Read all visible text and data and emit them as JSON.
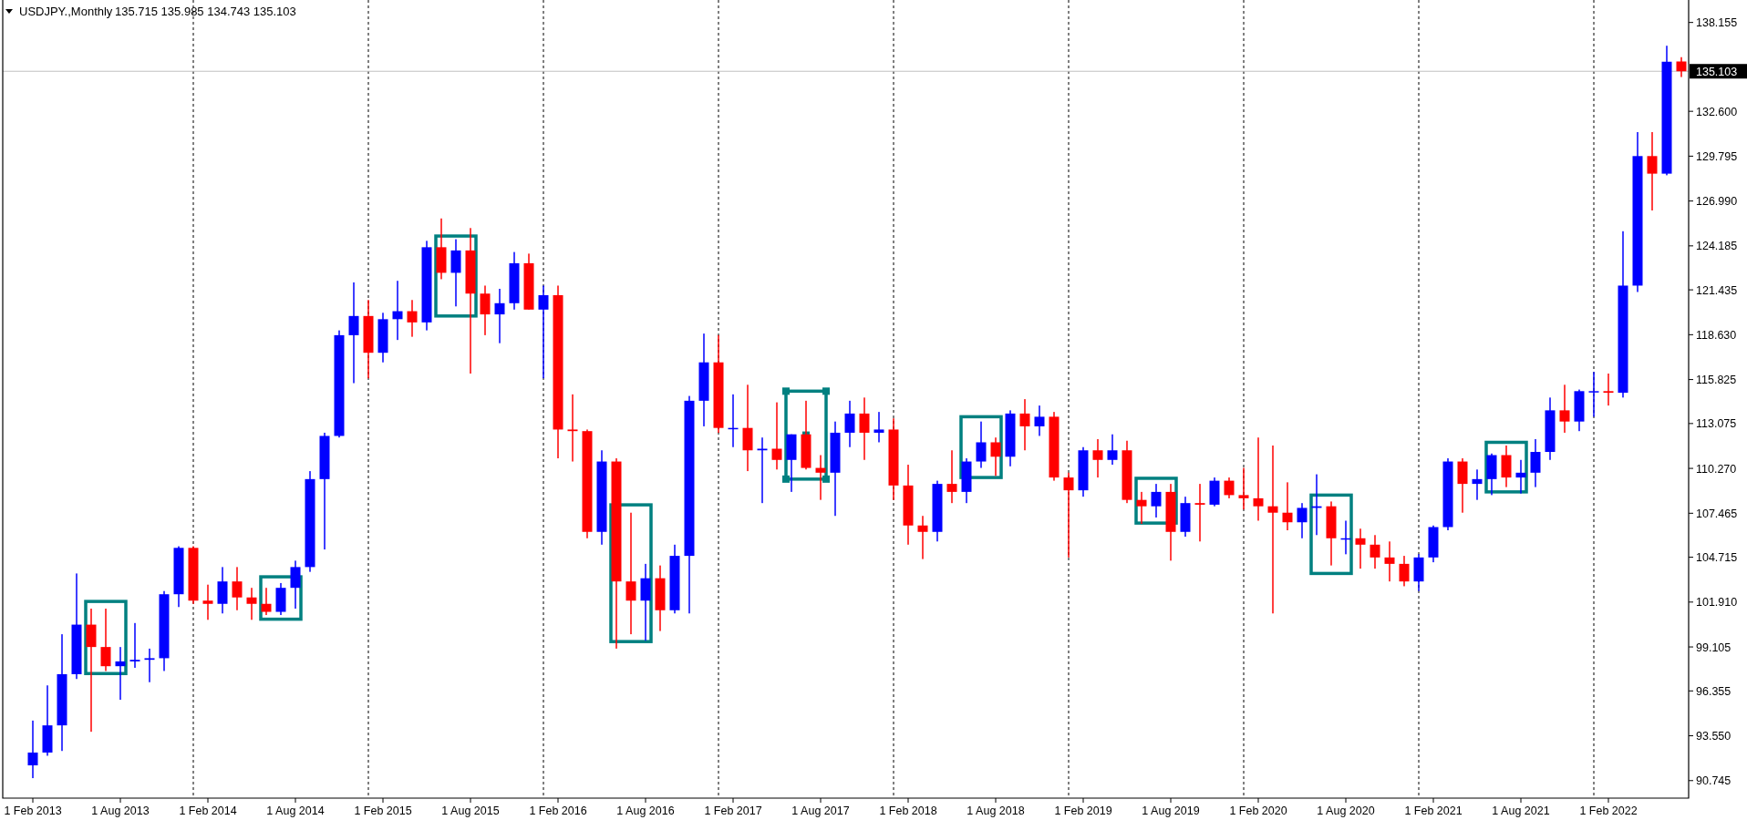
{
  "chart_header": {
    "symbol": "USDJPY.,Monthly",
    "quote": "135.715 135.985 134.743 135.103"
  },
  "chart_data": {
    "type": "candlestick",
    "grid": true,
    "ylim": [
      89.65,
      139.56
    ],
    "categories": [
      "1 Feb 2013",
      null,
      null,
      null,
      null,
      null,
      "1 Aug 2013",
      null,
      null,
      null,
      null,
      null,
      "1 Feb 2014",
      null,
      null,
      null,
      null,
      null,
      "1 Aug 2014",
      null,
      null,
      null,
      null,
      null,
      "1 Feb 2015",
      null,
      null,
      null,
      null,
      null,
      "1 Aug 2015",
      null,
      null,
      null,
      null,
      null,
      "1 Feb 2016",
      null,
      null,
      null,
      null,
      null,
      "1 Aug 2016",
      null,
      null,
      null,
      null,
      null,
      "1 Feb 2017",
      null,
      null,
      null,
      null,
      null,
      "1 Aug 2017",
      null,
      null,
      null,
      null,
      null,
      "1 Feb 2018",
      null,
      null,
      null,
      null,
      null,
      "1 Aug 2018",
      null,
      null,
      null,
      null,
      null,
      "1 Feb 2019",
      null,
      null,
      null,
      null,
      null,
      "1 Aug 2019",
      null,
      null,
      null,
      null,
      null,
      "1 Feb 2020",
      null,
      null,
      null,
      null,
      null,
      "1 Aug 2020",
      null,
      null,
      null,
      null,
      null,
      "1 Feb 2021",
      null,
      null,
      null,
      null,
      null,
      "1 Aug 2021",
      null,
      null,
      null,
      null,
      null,
      "1 Feb 2022",
      null,
      null,
      null,
      null,
      null
    ],
    "ohlc": [
      [
        91.7,
        94.5,
        90.9,
        92.5
      ],
      [
        92.5,
        96.7,
        92.3,
        94.2
      ],
      [
        94.2,
        99.9,
        92.6,
        97.4
      ],
      [
        97.4,
        103.7,
        97.1,
        100.5
      ],
      [
        100.5,
        101.5,
        93.8,
        99.1
      ],
      [
        99.1,
        101.5,
        97.6,
        97.9
      ],
      [
        97.9,
        99.1,
        95.8,
        98.2
      ],
      [
        98.2,
        100.6,
        97.8,
        98.3
      ],
      [
        98.3,
        99.0,
        96.9,
        98.4
      ],
      [
        98.4,
        102.6,
        97.6,
        102.4
      ],
      [
        102.4,
        105.4,
        101.6,
        105.3
      ],
      [
        105.3,
        105.4,
        101.8,
        102.0
      ],
      [
        102.0,
        103.0,
        100.8,
        101.8
      ],
      [
        101.8,
        104.1,
        101.2,
        103.2
      ],
      [
        103.2,
        104.1,
        101.4,
        102.2
      ],
      [
        102.2,
        102.8,
        100.8,
        101.8
      ],
      [
        101.8,
        102.8,
        101.1,
        101.3
      ],
      [
        101.3,
        103.1,
        101.1,
        102.8
      ],
      [
        102.8,
        104.5,
        101.5,
        104.1
      ],
      [
        104.1,
        110.1,
        103.8,
        109.6
      ],
      [
        109.6,
        112.5,
        105.2,
        112.3
      ],
      [
        112.3,
        118.9,
        112.2,
        118.6
      ],
      [
        118.6,
        121.9,
        115.6,
        119.8
      ],
      [
        119.8,
        120.8,
        115.9,
        117.5
      ],
      [
        117.5,
        120.0,
        116.9,
        119.6
      ],
      [
        119.6,
        122.0,
        118.3,
        120.1
      ],
      [
        120.1,
        120.8,
        118.5,
        119.4
      ],
      [
        119.4,
        124.5,
        118.9,
        124.1
      ],
      [
        124.1,
        125.9,
        122.1,
        122.5
      ],
      [
        122.5,
        124.6,
        120.4,
        123.9
      ],
      [
        123.9,
        125.3,
        116.2,
        121.2
      ],
      [
        121.2,
        121.7,
        118.6,
        119.9
      ],
      [
        119.9,
        121.5,
        118.1,
        120.6
      ],
      [
        120.6,
        123.8,
        120.2,
        123.1
      ],
      [
        123.1,
        123.7,
        120.2,
        120.2
      ],
      [
        120.2,
        121.7,
        115.9,
        121.1
      ],
      [
        121.1,
        121.7,
        110.9,
        112.7
      ],
      [
        112.7,
        114.9,
        110.7,
        112.6
      ],
      [
        112.6,
        112.7,
        105.9,
        106.3
      ],
      [
        106.3,
        111.4,
        105.5,
        110.7
      ],
      [
        110.7,
        110.9,
        99.0,
        103.2
      ],
      [
        103.2,
        107.5,
        99.9,
        102.0
      ],
      [
        102.0,
        104.3,
        99.5,
        103.4
      ],
      [
        103.4,
        104.2,
        100.1,
        101.4
      ],
      [
        101.4,
        105.5,
        101.2,
        104.8
      ],
      [
        104.8,
        114.8,
        101.2,
        114.5
      ],
      [
        114.5,
        118.7,
        112.9,
        116.9
      ],
      [
        116.9,
        118.6,
        112.5,
        112.8
      ],
      [
        112.8,
        114.9,
        111.6,
        112.8
      ],
      [
        112.8,
        115.5,
        110.1,
        111.4
      ],
      [
        111.4,
        112.2,
        108.1,
        111.5
      ],
      [
        111.5,
        114.4,
        110.2,
        110.8
      ],
      [
        110.8,
        112.4,
        108.8,
        112.4
      ],
      [
        112.4,
        114.5,
        110.2,
        110.3
      ],
      [
        110.3,
        111.1,
        108.3,
        110.0
      ],
      [
        110.0,
        113.2,
        107.3,
        112.5
      ],
      [
        112.5,
        114.5,
        111.6,
        113.7
      ],
      [
        113.7,
        114.7,
        110.8,
        112.5
      ],
      [
        112.5,
        113.8,
        111.9,
        112.7
      ],
      [
        112.7,
        113.4,
        108.3,
        109.2
      ],
      [
        109.2,
        110.5,
        105.5,
        106.7
      ],
      [
        106.7,
        107.3,
        104.6,
        106.3
      ],
      [
        106.3,
        109.5,
        105.7,
        109.3
      ],
      [
        109.3,
        111.4,
        108.1,
        108.8
      ],
      [
        108.8,
        110.9,
        108.1,
        110.7
      ],
      [
        110.7,
        113.2,
        110.3,
        111.9
      ],
      [
        111.9,
        112.2,
        109.8,
        111.0
      ],
      [
        111.0,
        113.9,
        110.4,
        113.7
      ],
      [
        113.7,
        114.6,
        111.4,
        112.9
      ],
      [
        112.9,
        114.2,
        112.3,
        113.5
      ],
      [
        113.5,
        113.8,
        109.5,
        109.7
      ],
      [
        109.7,
        110.0,
        104.7,
        108.9
      ],
      [
        108.9,
        111.6,
        108.5,
        111.4
      ],
      [
        111.4,
        112.1,
        109.7,
        110.8
      ],
      [
        110.8,
        112.4,
        110.5,
        111.4
      ],
      [
        111.4,
        112.0,
        108.1,
        108.3
      ],
      [
        108.3,
        108.8,
        106.8,
        107.9
      ],
      [
        107.9,
        109.3,
        107.2,
        108.8
      ],
      [
        108.8,
        109.3,
        104.5,
        106.3
      ],
      [
        106.3,
        108.5,
        106.0,
        108.1
      ],
      [
        108.1,
        109.3,
        105.7,
        108.0
      ],
      [
        108.0,
        109.7,
        107.9,
        109.5
      ],
      [
        109.5,
        109.7,
        108.4,
        108.6
      ],
      [
        108.6,
        110.3,
        107.7,
        108.4
      ],
      [
        108.4,
        112.2,
        107.0,
        107.9
      ],
      [
        107.9,
        111.7,
        101.2,
        107.5
      ],
      [
        107.5,
        109.4,
        106.4,
        106.9
      ],
      [
        106.9,
        108.1,
        105.9,
        107.8
      ],
      [
        107.8,
        109.9,
        106.1,
        107.9
      ],
      [
        107.9,
        108.2,
        104.2,
        105.9
      ],
      [
        105.9,
        107.0,
        104.9,
        105.9
      ],
      [
        105.9,
        106.5,
        104.0,
        105.5
      ],
      [
        105.5,
        106.1,
        104.0,
        104.7
      ],
      [
        104.7,
        105.7,
        103.2,
        104.3
      ],
      [
        104.3,
        104.8,
        102.9,
        103.2
      ],
      [
        103.2,
        104.9,
        102.6,
        104.7
      ],
      [
        104.7,
        106.7,
        104.4,
        106.6
      ],
      [
        106.6,
        110.9,
        106.4,
        110.7
      ],
      [
        110.7,
        110.9,
        107.5,
        109.3
      ],
      [
        109.3,
        110.2,
        108.3,
        109.6
      ],
      [
        109.6,
        111.2,
        108.6,
        111.1
      ],
      [
        111.1,
        111.7,
        109.1,
        109.7
      ],
      [
        109.7,
        110.8,
        108.7,
        110.0
      ],
      [
        110.0,
        112.1,
        109.1,
        111.3
      ],
      [
        111.3,
        114.7,
        110.8,
        113.9
      ],
      [
        113.9,
        115.5,
        112.5,
        113.2
      ],
      [
        113.2,
        115.2,
        112.6,
        115.1
      ],
      [
        115.1,
        116.3,
        113.5,
        115.1
      ],
      [
        115.1,
        116.2,
        114.2,
        115.0
      ],
      [
        115.0,
        125.1,
        114.7,
        121.7
      ],
      [
        121.7,
        131.3,
        121.3,
        129.8
      ],
      [
        129.8,
        131.3,
        126.4,
        128.7
      ],
      [
        128.7,
        136.7,
        128.6,
        135.7
      ],
      [
        135.715,
        135.985,
        134.743,
        135.103
      ]
    ],
    "yticks": [
      {
        "value": 138.155,
        "label": "138.155"
      },
      {
        "value": 132.6,
        "label": "132.600"
      },
      {
        "value": 129.795,
        "label": "129.795"
      },
      {
        "value": 126.99,
        "label": "126.990"
      },
      {
        "value": 124.185,
        "label": "124.185"
      },
      {
        "value": 121.435,
        "label": "121.435"
      },
      {
        "value": 118.63,
        "label": "118.630"
      },
      {
        "value": 115.825,
        "label": "115.825"
      },
      {
        "value": 113.075,
        "label": "113.075"
      },
      {
        "value": 110.27,
        "label": "110.270"
      },
      {
        "value": 107.465,
        "label": "107.465"
      },
      {
        "value": 104.715,
        "label": "104.715"
      },
      {
        "value": 101.91,
        "label": "101.910"
      },
      {
        "value": 99.105,
        "label": "99.105"
      },
      {
        "value": 96.355,
        "label": "96.355"
      },
      {
        "value": 93.55,
        "label": "93.550"
      },
      {
        "value": 90.745,
        "label": "90.745"
      }
    ],
    "ref_lines": [
      {
        "axis": "y",
        "value": 135.103,
        "label": "135.103"
      }
    ]
  },
  "drawn_rectangles": [
    {
      "selected": false
    },
    {
      "selected": false
    },
    {
      "selected": false
    },
    {
      "selected": false
    },
    {
      "selected": true
    },
    {
      "selected": false
    },
    {
      "selected": false
    },
    {
      "selected": false
    },
    {
      "selected": false
    }
  ]
}
